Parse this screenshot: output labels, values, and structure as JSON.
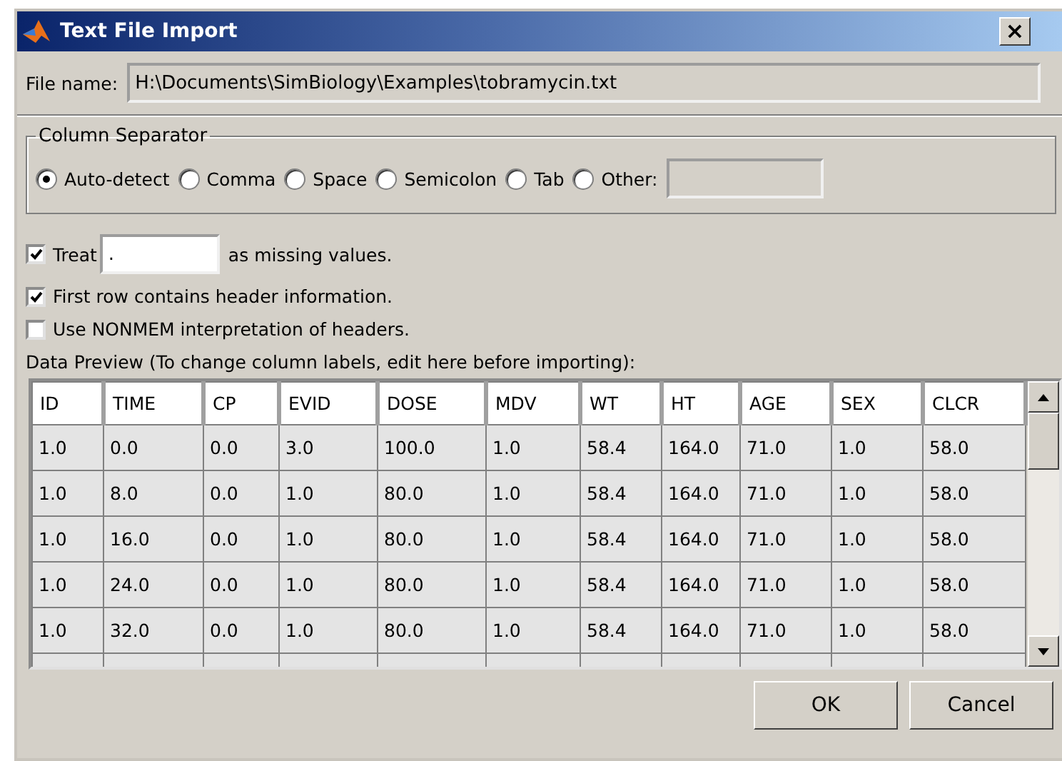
{
  "window": {
    "title": "Text File Import",
    "close": "×"
  },
  "file_name": {
    "label": "File name:",
    "value": "H:\\Documents\\SimBiology\\Examples\\tobramycin.txt"
  },
  "column_separator": {
    "title": "Column Separator",
    "options": [
      {
        "label": "Auto-detect",
        "selected": true
      },
      {
        "label": "Comma",
        "selected": false
      },
      {
        "label": "Space",
        "selected": false
      },
      {
        "label": "Semicolon",
        "selected": false
      },
      {
        "label": "Tab",
        "selected": false
      },
      {
        "label": "Other:",
        "selected": false
      }
    ]
  },
  "treat": {
    "label": "Treat",
    "checked": true,
    "value": ".",
    "suffix": "as missing values."
  },
  "options": [
    {
      "label": "First row contains header information.",
      "checked": true
    },
    {
      "label": "Use NONMEM interpretation of headers.",
      "checked": false
    }
  ],
  "preview_label": "Data Preview (To change column labels, edit here before importing):",
  "table": {
    "columns": [
      "ID",
      "TIME",
      "CP",
      "EVID",
      "DOSE",
      "MDV",
      "WT",
      "HT",
      "AGE",
      "SEX",
      "CLCR"
    ],
    "rows": [
      [
        "1.0",
        "0.0",
        "0.0",
        "3.0",
        "100.0",
        "1.0",
        "58.4",
        "164.0",
        "71.0",
        "1.0",
        "58.0"
      ],
      [
        "1.0",
        "8.0",
        "0.0",
        "1.0",
        "80.0",
        "1.0",
        "58.4",
        "164.0",
        "71.0",
        "1.0",
        "58.0"
      ],
      [
        "1.0",
        "16.0",
        "0.0",
        "1.0",
        "80.0",
        "1.0",
        "58.4",
        "164.0",
        "71.0",
        "1.0",
        "58.0"
      ],
      [
        "1.0",
        "24.0",
        "0.0",
        "1.0",
        "80.0",
        "1.0",
        "58.4",
        "164.0",
        "71.0",
        "1.0",
        "58.0"
      ],
      [
        "1.0",
        "32.0",
        "0.0",
        "1.0",
        "80.0",
        "1.0",
        "58.4",
        "164.0",
        "71.0",
        "1.0",
        "58.0"
      ]
    ]
  },
  "buttons": [
    "OK",
    "Cancel"
  ]
}
